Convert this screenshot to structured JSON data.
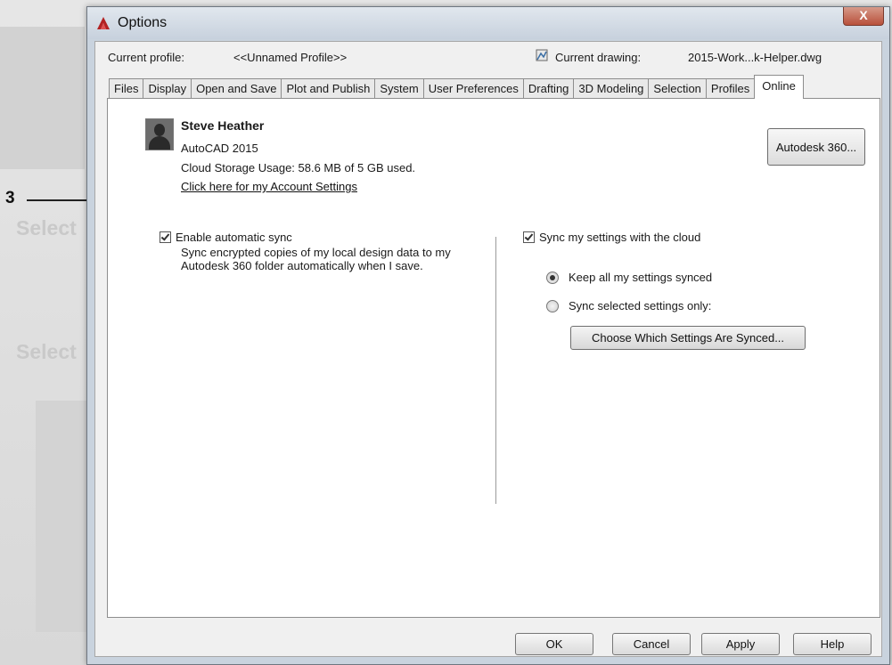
{
  "dialog": {
    "title": "Options",
    "close_symbol": "X"
  },
  "profile": {
    "label": "Current profile:",
    "value": "<<Unnamed Profile>>"
  },
  "drawing": {
    "label": "Current drawing:",
    "value": "2015-Work...k-Helper.dwg"
  },
  "tabs": [
    {
      "label": "Files"
    },
    {
      "label": "Display"
    },
    {
      "label": "Open and Save"
    },
    {
      "label": "Plot and Publish"
    },
    {
      "label": "System"
    },
    {
      "label": "User Preferences"
    },
    {
      "label": "Drafting"
    },
    {
      "label": "3D Modeling"
    },
    {
      "label": "Selection"
    },
    {
      "label": "Profiles"
    },
    {
      "label": "Online"
    }
  ],
  "active_tab": "Online",
  "account": {
    "name": "Steve Heather",
    "product": "AutoCAD 2015",
    "storage": "Cloud Storage Usage: 58.6 MB of 5 GB used.",
    "link": "Click here for my Account Settings"
  },
  "autodesk360_button": "Autodesk 360...",
  "sync": {
    "enable_label": "Enable automatic sync",
    "enable_checked": true,
    "description": "Sync encrypted copies of my local design data to my Autodesk 360 folder automatically when I save."
  },
  "settings_sync": {
    "label": "Sync my settings with the cloud",
    "checked": true,
    "option_all": "Keep all my settings synced",
    "option_selected": "Sync selected settings only:",
    "selected_option": "all",
    "choose_button": "Choose Which Settings Are Synced..."
  },
  "footer": {
    "ok": "OK",
    "cancel": "Cancel",
    "apply": "Apply",
    "help": "Help"
  },
  "callout": {
    "number": "3"
  },
  "colors": {
    "dialog_frame": "#c9d3de",
    "close_button": "#b8503b",
    "panel_background": "#ffffff"
  },
  "icons": {
    "app": "autocad-logo-icon",
    "drawing": "drawing-file-icon",
    "avatar": "user-avatar-icon"
  }
}
